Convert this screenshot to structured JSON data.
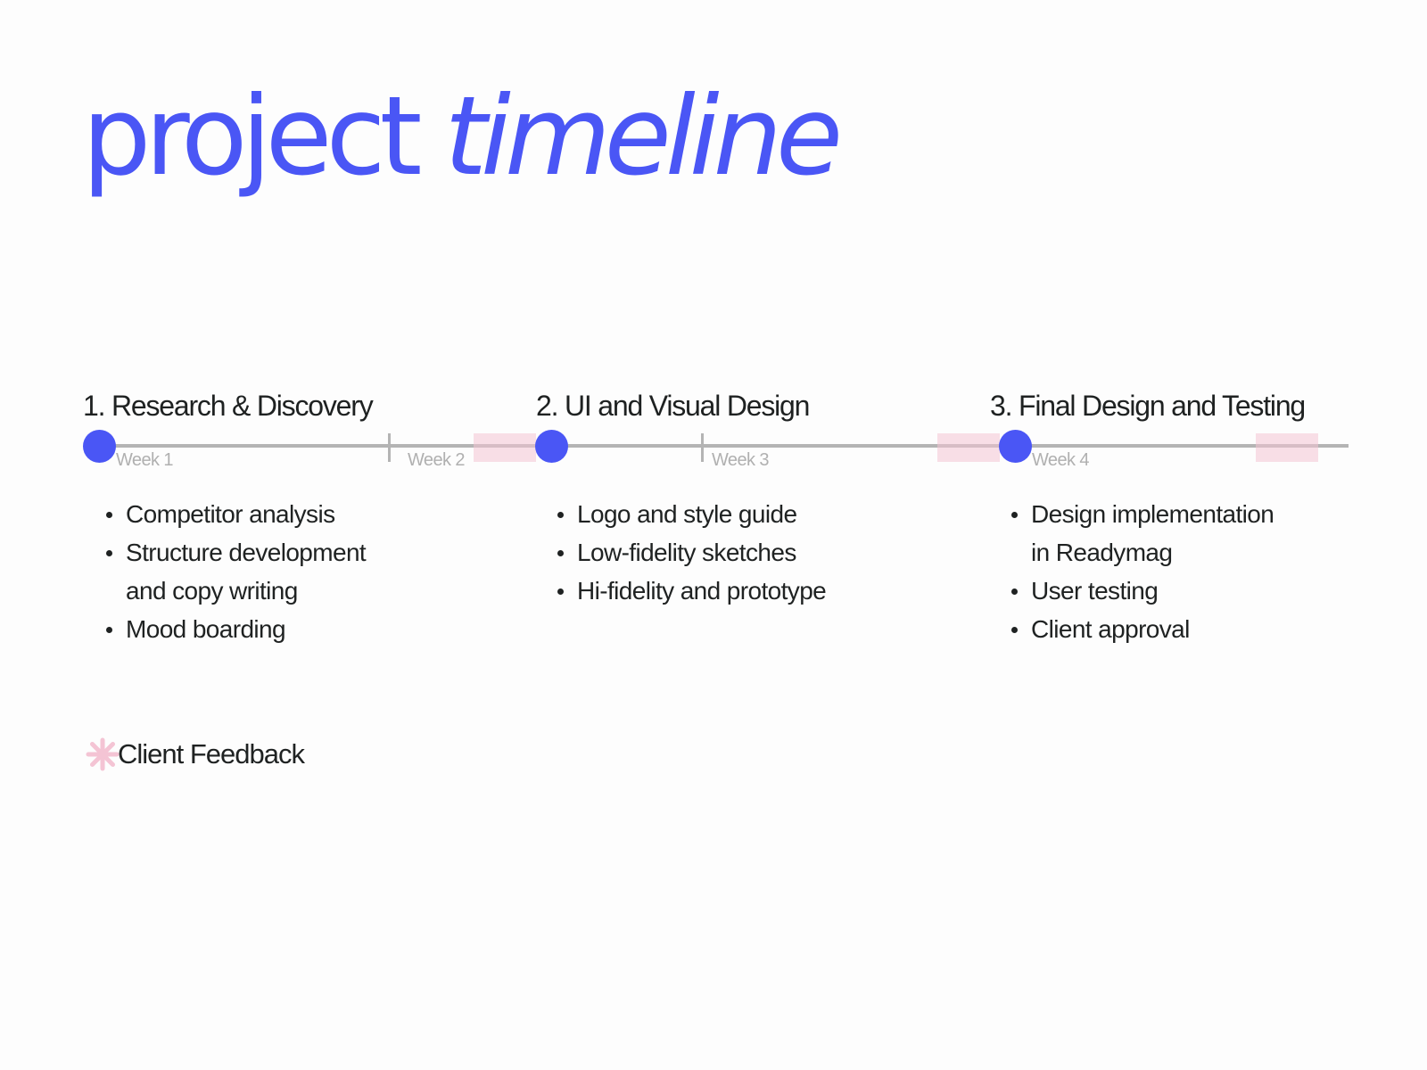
{
  "title": {
    "part1": "project",
    "part2": "timeline"
  },
  "colors": {
    "accent": "#4a56f5",
    "feedback": "#f4c4d4",
    "line": "#b4b4b4",
    "text": "#1f2222",
    "week_text": "#b0b0b0"
  },
  "phases": [
    {
      "title": "1. Research & Discovery",
      "tasks": [
        "Competitor analysis",
        "Structure development\nand copy writing",
        "Mood boarding"
      ]
    },
    {
      "title": "2. UI and Visual Design",
      "tasks": [
        "Logo and style guide",
        "Low-fidelity sketches",
        "Hi-fidelity and prototype"
      ]
    },
    {
      "title": "3. Final Design and Testing",
      "tasks": [
        "Design implementation\nin Readymag",
        "User testing",
        "Client approval"
      ]
    }
  ],
  "weeks": [
    "Week 1",
    "Week 2",
    "Week 3",
    "Week 4"
  ],
  "legend": {
    "icon": "asterisk-icon",
    "label": "Client Feedback"
  }
}
